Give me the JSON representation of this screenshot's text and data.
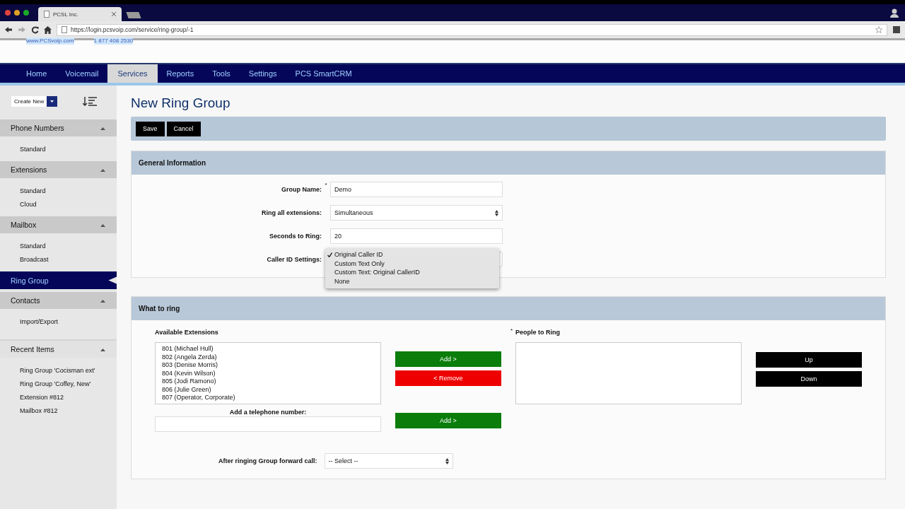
{
  "browser": {
    "tab_title": "PCSL Inc.",
    "url": "https://login.pcsvoip.com/service/ring-group/-1"
  },
  "header": {
    "website": "www.PCSvoip.com",
    "phone": "1 877 408 2530"
  },
  "nav": [
    {
      "label": "Home",
      "selected": false
    },
    {
      "label": "Voicemail",
      "selected": false
    },
    {
      "label": "Services",
      "selected": true
    },
    {
      "label": "Reports",
      "selected": false
    },
    {
      "label": "Tools",
      "selected": false
    },
    {
      "label": "Settings",
      "selected": false
    },
    {
      "label": "PCS SmartCRM",
      "selected": false
    }
  ],
  "sidebar": {
    "create_button": "Create New",
    "sections": [
      {
        "kind": "group",
        "title": "Phone Numbers",
        "expanded": true,
        "items": [
          "Standard"
        ]
      },
      {
        "kind": "group",
        "title": "Extensions",
        "expanded": true,
        "items": [
          "Standard",
          "Cloud"
        ]
      },
      {
        "kind": "group",
        "title": "Mailbox",
        "expanded": true,
        "items": [
          "Standard",
          "Broadcast"
        ]
      },
      {
        "kind": "link",
        "title": "Ring Group",
        "selected": true
      },
      {
        "kind": "group",
        "title": "Contacts",
        "expanded": true,
        "items": [
          "Import/Export"
        ]
      },
      {
        "kind": "group",
        "title": "Recent Items",
        "expanded": true,
        "items": [
          "Ring Group 'Cocisman ext'",
          "Ring Group 'Coffey, New'",
          "Extension #812",
          "Mailbox #812"
        ]
      }
    ]
  },
  "page_title": "New Ring Group",
  "toolbar": [
    "Save",
    "Cancel"
  ],
  "general": {
    "title": "General Information",
    "fields": [
      {
        "kind": "text",
        "label": "Group Name:",
        "required_mark": "*",
        "value": "Demo"
      },
      {
        "kind": "select",
        "label": "Ring all extensions:",
        "value": "Simultaneous"
      },
      {
        "kind": "text",
        "label": "Seconds to Ring:",
        "value": "20"
      },
      {
        "kind": "open_select",
        "label": "Caller ID Settings:",
        "options": [
          {
            "label": "Original Caller ID",
            "selected": true
          },
          {
            "label": "Custom Text Only",
            "selected": false
          },
          {
            "label": "Custom Text: Original CallerID",
            "selected": false
          },
          {
            "label": "None",
            "selected": false
          }
        ]
      }
    ]
  },
  "ring": {
    "title": "What to ring",
    "available_label": "Available Extensions",
    "available": [
      "801 (Michael Hull)",
      "802 (Angela Zerda)",
      "803 (Denise Morris)",
      "804 (Kevin Wilson)",
      "805 (Jodi Ramono)",
      "806 (Julie Green)",
      "807 (Operator, Corporate)"
    ],
    "add_button": "Add >",
    "remove_button": "< Remove",
    "people_label": "People to Ring",
    "people_required_mark": "*",
    "up_button": "Up",
    "down_button": "Down",
    "phone_label": "Add a telephone number:",
    "phone_add_button": "Add >",
    "forward_label": "After ringing Group forward call:",
    "forward_value": "-- Select --"
  }
}
